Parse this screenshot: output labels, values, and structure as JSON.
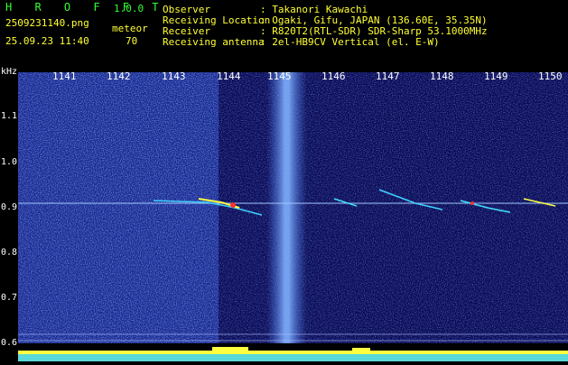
{
  "app": {
    "title": "H R O F F T",
    "version": "1.0.0",
    "filename": "2509231140.png",
    "datetime": "25.09.23 11:40",
    "meteor_label": "meteor",
    "meteor_count": "70"
  },
  "info": {
    "rows": [
      {
        "label": "Observer",
        "value": ": Takanori Kawachi"
      },
      {
        "label": "Receiving Location",
        "value": ": Ogaki, Gifu, JAPAN (136.60E, 35.35N)"
      },
      {
        "label": "Receiver",
        "value": ": R820T2(RTL-SDR) SDR-Sharp 53.1000MHz"
      },
      {
        "label": "Receiving antenna",
        "value": ": 2el-HB9CV Vertical (el. E-W)"
      }
    ]
  },
  "axes": {
    "y_unit": "kHz",
    "x_ticks": [
      "1141",
      "1142",
      "1143",
      "1144",
      "1145",
      "1146",
      "1147",
      "1148",
      "1149",
      "1150"
    ],
    "y_ticks": [
      "1.1",
      "1.0",
      "0.9",
      "0.8",
      "0.7",
      "0.6"
    ]
  },
  "colors": {
    "background": "#0a0a55",
    "noise": "#3a5bd8",
    "carrier": "#b0d0ff",
    "meteor_hot": "#ff3030",
    "meteor_warm": "#ffff40",
    "header_yellow": "#ffff33",
    "header_green": "#33ff33"
  }
}
